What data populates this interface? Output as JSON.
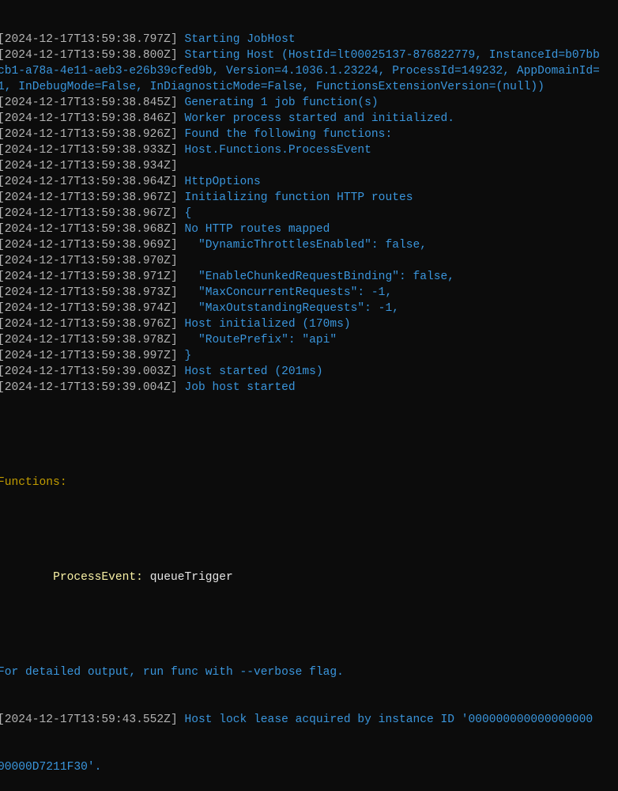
{
  "colors": {
    "background": "#0c0c0c",
    "timestamp": "#b4b4b4",
    "info": "#3a96dd",
    "heading": "#c19c00",
    "function_name": "#f9f1a5",
    "trigger": "#e6e6e6"
  },
  "lines": [
    {
      "ts": "[2024-12-17T13:59:38.797Z] ",
      "msg": "Starting JobHost"
    },
    {
      "ts": "[2024-12-17T13:59:38.800Z] ",
      "msg": "Starting Host (HostId=lt00025137-876822779, InstanceId=b07bb"
    },
    {
      "ts": "",
      "msg": "cb1-a78a-4e11-aeb3-e26b39cfed9b, Version=4.1036.1.23224, ProcessId=149232, AppDomainId="
    },
    {
      "ts": "",
      "msg": "1, InDebugMode=False, InDiagnosticMode=False, FunctionsExtensionVersion=(null))"
    },
    {
      "ts": "[2024-12-17T13:59:38.845Z] ",
      "msg": "Generating 1 job function(s)"
    },
    {
      "ts": "[2024-12-17T13:59:38.846Z] ",
      "msg": "Worker process started and initialized."
    },
    {
      "ts": "[2024-12-17T13:59:38.926Z] ",
      "msg": "Found the following functions:"
    },
    {
      "ts": "[2024-12-17T13:59:38.933Z] ",
      "msg": "Host.Functions.ProcessEvent"
    },
    {
      "ts": "[2024-12-17T13:59:38.934Z]",
      "msg": ""
    },
    {
      "ts": "[2024-12-17T13:59:38.964Z] ",
      "msg": "HttpOptions"
    },
    {
      "ts": "[2024-12-17T13:59:38.967Z] ",
      "msg": "Initializing function HTTP routes"
    },
    {
      "ts": "[2024-12-17T13:59:38.967Z] ",
      "msg": "{"
    },
    {
      "ts": "[2024-12-17T13:59:38.968Z] ",
      "msg": "No HTTP routes mapped"
    },
    {
      "ts": "[2024-12-17T13:59:38.969Z] ",
      "msg": "  \"DynamicThrottlesEnabled\": false,"
    },
    {
      "ts": "[2024-12-17T13:59:38.970Z]",
      "msg": ""
    },
    {
      "ts": "[2024-12-17T13:59:38.971Z] ",
      "msg": "  \"EnableChunkedRequestBinding\": false,"
    },
    {
      "ts": "[2024-12-17T13:59:38.973Z] ",
      "msg": "  \"MaxConcurrentRequests\": -1,"
    },
    {
      "ts": "[2024-12-17T13:59:38.974Z] ",
      "msg": "  \"MaxOutstandingRequests\": -1,"
    },
    {
      "ts": "[2024-12-17T13:59:38.976Z] ",
      "msg": "Host initialized (170ms)"
    },
    {
      "ts": "[2024-12-17T13:59:38.978Z] ",
      "msg": "  \"RoutePrefix\": \"api\""
    },
    {
      "ts": "[2024-12-17T13:59:38.997Z] ",
      "msg": "}"
    },
    {
      "ts": "[2024-12-17T13:59:39.003Z] ",
      "msg": "Host started (201ms)"
    },
    {
      "ts": "[2024-12-17T13:59:39.004Z] ",
      "msg": "Job host started"
    }
  ],
  "functions_heading": "Functions:",
  "function_entry": {
    "name": "ProcessEvent:",
    "trigger": "queueTrigger"
  },
  "verbose_hint": "For detailed output, run func with --verbose flag.",
  "lock_line": {
    "ts": "[2024-12-17T13:59:43.552Z] ",
    "msg": "Host lock lease acquired by instance ID '000000000000000000"
  },
  "lock_line_cont": "00000D7211F30'."
}
